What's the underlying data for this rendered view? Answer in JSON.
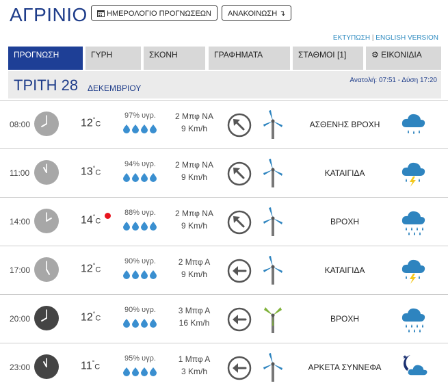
{
  "city": "ΑΓΡΙΝΙΟ",
  "header": {
    "calendar_button": "ΗΜΕΡΟΛΟΓΙΟ ΠΡΟΓΝΩΣΕΩΝ",
    "announce_button": "ΑΝΑΚΟΙΝΩΣΗ",
    "print_link": "ΕΚΤΥΠΩΣΗ",
    "english_link": "ENGLISH VERSION"
  },
  "tabs": [
    {
      "label": "ΠΡΟΓΝΩΣΗ",
      "active": true
    },
    {
      "label": "ΓΥΡΗ",
      "active": false
    },
    {
      "label": "ΣΚΟΝΗ",
      "active": false
    },
    {
      "label": "ΓΡΑΦΗΜΑΤΑ",
      "active": false
    },
    {
      "label": "ΣΤΑΘΜΟΙ [1]",
      "active": false
    },
    {
      "label": "ΕΙΚΟΝΙΔΙΑ",
      "active": false
    }
  ],
  "day": {
    "name": "ΤΡΙΤΗ 28",
    "month": "ΔΕΚΕΜΒΡΙΟΥ",
    "sun": "Ανατολή: 07:51 - Δύση 17:20"
  },
  "colors": {
    "brand": "#1e3f96",
    "drop": "#3a8fd0",
    "clock_day": "#a7a7a7",
    "clock_night": "#444444",
    "warning": "#e8141e"
  },
  "rows": [
    {
      "time": "08:00",
      "temp": "12",
      "unit": "C",
      "warning": false,
      "humidity": "97% υγρ.",
      "wind": "2 Μπφ ΝΑ",
      "speed": "9 Km/h",
      "direction": "NW",
      "turbine": "blue",
      "night": false,
      "desc": "ΑΣΘΕΝΗΣ ΒΡΟΧΗ",
      "icon": "light-rain-icon"
    },
    {
      "time": "11:00",
      "temp": "13",
      "unit": "C",
      "warning": false,
      "humidity": "94% υγρ.",
      "wind": "2 Μπφ ΝΑ",
      "speed": "9 Km/h",
      "direction": "NW",
      "turbine": "blue",
      "night": false,
      "desc": "ΚΑΤΑΙΓΙΔΑ",
      "icon": "thunderstorm-icon"
    },
    {
      "time": "14:00",
      "temp": "14",
      "unit": "C",
      "warning": true,
      "humidity": "88% υγρ.",
      "wind": "2 Μπφ ΝΑ",
      "speed": "9 Km/h",
      "direction": "NW",
      "turbine": "blue",
      "night": false,
      "desc": "ΒΡΟΧΗ",
      "icon": "rain-icon"
    },
    {
      "time": "17:00",
      "temp": "12",
      "unit": "C",
      "warning": false,
      "humidity": "90% υγρ.",
      "wind": "2 Μπφ Α",
      "speed": "9 Km/h",
      "direction": "W",
      "turbine": "blue",
      "night": false,
      "desc": "ΚΑΤΑΙΓΙΔΑ",
      "icon": "thunderstorm-icon"
    },
    {
      "time": "20:00",
      "temp": "12",
      "unit": "C",
      "warning": false,
      "humidity": "90% υγρ.",
      "wind": "3 Μπφ Α",
      "speed": "16 Km/h",
      "direction": "W",
      "turbine": "green",
      "night": true,
      "desc": "ΒΡΟΧΗ",
      "icon": "rain-icon"
    },
    {
      "time": "23:00",
      "temp": "11",
      "unit": "C",
      "warning": false,
      "humidity": "95% υγρ.",
      "wind": "1 Μπφ Α",
      "speed": "3 Km/h",
      "direction": "W",
      "turbine": "blue",
      "night": true,
      "desc": "ΑΡΚΕΤΑ ΣΥΝΝΕΦΑ",
      "icon": "night-cloudy-icon"
    }
  ]
}
